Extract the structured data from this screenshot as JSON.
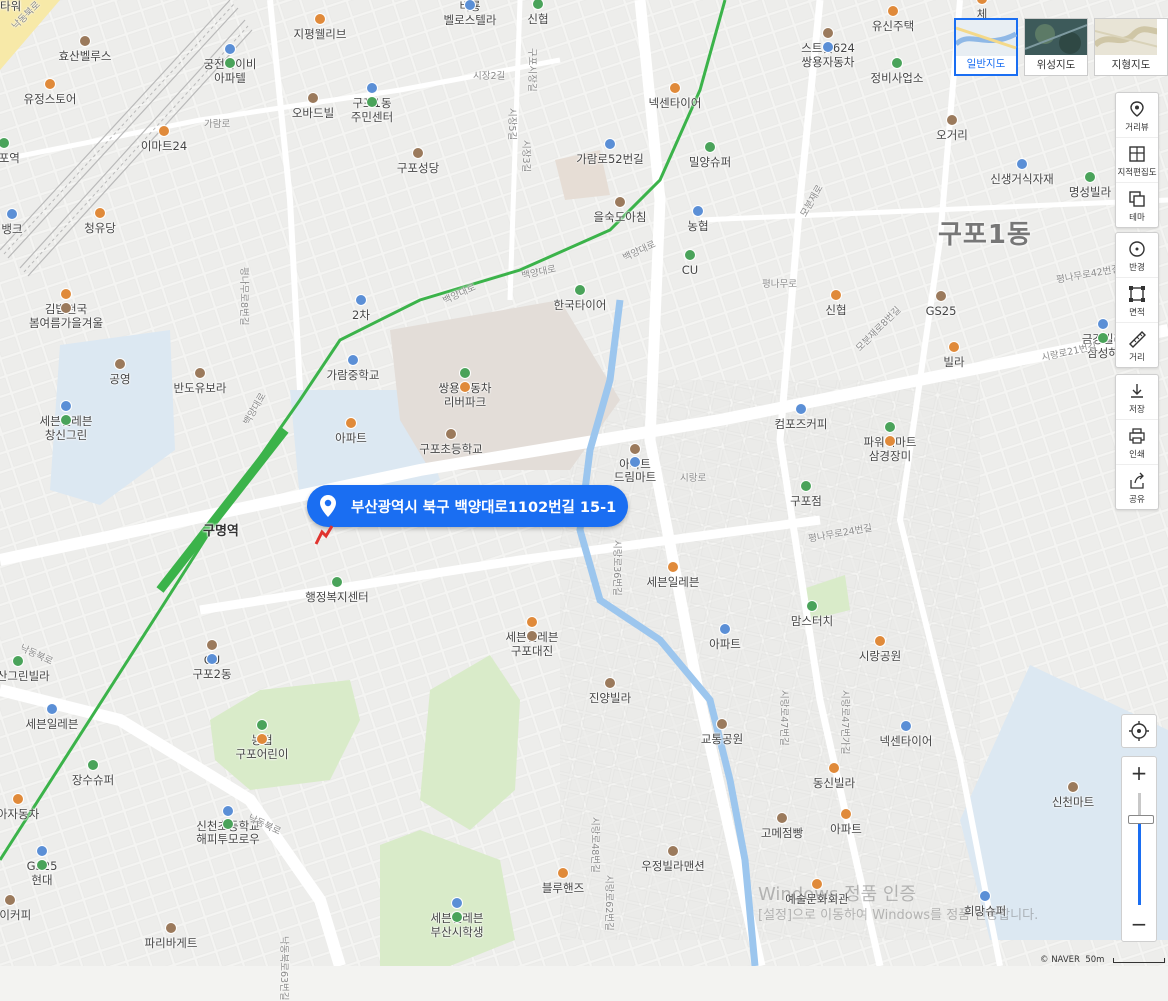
{
  "search_marker": {
    "address": "부산광역시 북구 백양대로1102번길 15-1"
  },
  "district": "구포1동",
  "map_types": [
    {
      "label": "일반지도",
      "active": true
    },
    {
      "label": "위성지도",
      "active": false
    },
    {
      "label": "지형지도",
      "active": false
    }
  ],
  "tools_group1": [
    {
      "label": "거리뷰",
      "icon": "street-view-icon"
    },
    {
      "label": "지적편집도",
      "icon": "cadastral-map-icon"
    },
    {
      "label": "테마",
      "icon": "theme-icon"
    }
  ],
  "tools_group2": [
    {
      "label": "반경",
      "icon": "radius-icon"
    },
    {
      "label": "면적",
      "icon": "area-icon"
    },
    {
      "label": "거리",
      "icon": "distance-ruler-icon"
    }
  ],
  "tools_group3": [
    {
      "label": "저장",
      "icon": "download-icon"
    },
    {
      "label": "인쇄",
      "icon": "print-icon"
    },
    {
      "label": "공유",
      "icon": "share-icon"
    }
  ],
  "zoom": {
    "plus": "+",
    "minus": "−"
  },
  "watermark": {
    "line1": "Windows 정품 인증",
    "line2": "[설정]으로 이동하여 Windows를 정품 인증합니다."
  },
  "attribution": "© NAVER",
  "scale_label": "50m",
  "station": {
    "name": "구명역"
  },
  "places": [
    "효산벨루스",
    "궁전아이비",
    "아파텔",
    "지평웰리브",
    "비룡",
    "벨로스텔라",
    "신협",
    "유정스토어",
    "오바드빌",
    "구포1동",
    "주민센터",
    "이마트24",
    "구포성당",
    "가람로52번길",
    "밀양슈퍼",
    "넥센타이어",
    "스트릿624",
    "쌍용자동차",
    "정비사업소",
    "유신주택",
    "오거리",
    "신생거식자재",
    "명성빌라",
    "청유당",
    "을숙도아침",
    "농협",
    "CU",
    "김밥천국",
    "봄여름가을겨울",
    "2차",
    "한국타이어",
    "신협",
    "GS25",
    "금강빌라",
    "삼성하",
    "빌라",
    "공영",
    "가람중학교",
    "쌍용자동차",
    "리버파크",
    "반도유보라",
    "세븐일레븐",
    "창신그린",
    "아파트",
    "구포초등학교",
    "컴포즈커피",
    "파워씨마트",
    "삼경장미",
    "아파트",
    "드림마트",
    "구포점",
    "세븐일레븐",
    "CU",
    "구포2동",
    "행정복지센터",
    "세븐일레븐",
    "구포대진",
    "아파트",
    "맘스터치",
    "시랑공원",
    "진양빌라",
    "세븐일레븐",
    "농협",
    "구포어린이",
    "교통공원",
    "넥센타이어",
    "장수슈퍼",
    "동신빌라",
    "신천마트",
    "신천초등학교",
    "해피투모로우",
    "아파트",
    "고메점빵",
    "GS25",
    "현대",
    "블루핸즈",
    "우정빌라맨션",
    "세븐일레븐",
    "부산시학생",
    "예술문화회관",
    "파리바게트",
    "희망슈퍼",
    "덕산그린빌라",
    "아자동차",
    "아이커피",
    "뱅크",
    "구포역",
    "체",
    "리체타워"
  ],
  "roads": [
    "낙동북로",
    "가람로",
    "백양대로",
    "백양대로",
    "백양대로",
    "시장2길",
    "구포시장길",
    "시장5길",
    "시장3길",
    "백양대로",
    "평나무로",
    "평나무로42번길",
    "시랑로21번길",
    "시랑로",
    "시랑로36번길",
    "시랑로47번가길",
    "시랑로47번길",
    "시랑로48번길",
    "시랑로62번길",
    "모분재로",
    "낙동북로",
    "낙동북로",
    "낙동북로63번길",
    "평나무로8번길",
    "평나무로24번길",
    "모분재로8번길"
  ]
}
